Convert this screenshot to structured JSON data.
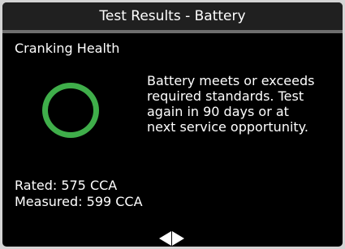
{
  "header": {
    "title": "Test Results - Battery"
  },
  "section": {
    "title": "Cranking Health"
  },
  "status": {
    "icon": "ring-icon",
    "color": "#3fae4a",
    "message_lines": [
      "Battery meets or exceeds",
      "required standards. Test",
      "again in 90 days or at",
      "next service opportunity."
    ]
  },
  "readings": {
    "rated": "Rated: 575 CCA",
    "measured": "Measured: 599 CCA"
  },
  "navigation": {
    "previous_icon": "arrow-left-icon",
    "next_icon": "arrow-right-icon"
  }
}
